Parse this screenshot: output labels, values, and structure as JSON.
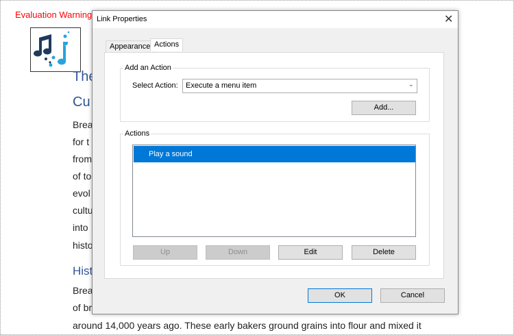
{
  "document": {
    "warning": "Evaluation Warning",
    "heading1": "The",
    "heading2": "Cu",
    "lines": [
      "Brea",
      "for t",
      "from",
      "of to",
      "evol",
      "cultu",
      "into",
      "histo"
    ],
    "heading3": "Hist",
    "lines2": [
      "Brea",
      "of br"
    ],
    "last_line": "around 14,000 years ago. These early bakers ground grains into flour and mixed it"
  },
  "dialog": {
    "title": "Link Properties",
    "tabs": [
      "Appearance",
      "Actions"
    ],
    "add_group": "Add an Action",
    "select_label": "Select Action:",
    "select_value": "Execute a menu item",
    "add_button": "Add...",
    "actions_group": "Actions",
    "actions": [
      "Play a sound"
    ],
    "buttons": {
      "up": "Up",
      "down": "Down",
      "edit": "Edit",
      "delete": "Delete"
    },
    "ok": "OK",
    "cancel": "Cancel"
  },
  "colors": {
    "selection": "#0078d7",
    "heading": "#2f5597",
    "warning": "#ff0000"
  }
}
